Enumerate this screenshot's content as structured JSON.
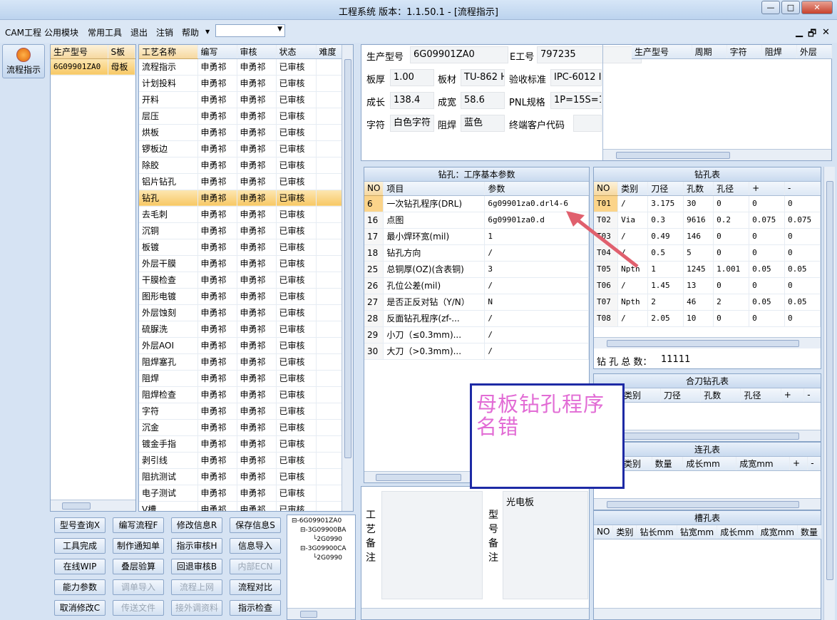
{
  "window": {
    "title": "工程系统   版本：1.1.50.1 - [流程指示]",
    "min": "—",
    "max": "□",
    "close": "✕"
  },
  "menu": {
    "items": [
      "CAM工程",
      "公用模块",
      "常用工具",
      "退出",
      "注销",
      "帮助"
    ],
    "combo_value": "",
    "mdi": [
      "▁",
      "🗗",
      "✕"
    ]
  },
  "side": {
    "label": "流程指示"
  },
  "model_list": {
    "headers": [
      "生产型号",
      "S板"
    ],
    "rows": [
      [
        "6G09901ZA0",
        "母板"
      ]
    ]
  },
  "process": {
    "headers": [
      "工艺名称",
      "编写",
      "审核",
      "状态",
      "难度"
    ],
    "rows": [
      [
        "流程指示",
        "申勇祁",
        "申勇祁",
        "已审核"
      ],
      [
        "计划投料",
        "申勇祁",
        "申勇祁",
        "已审核"
      ],
      [
        "开料",
        "申勇祁",
        "申勇祁",
        "已审核"
      ],
      [
        "层压",
        "申勇祁",
        "申勇祁",
        "已审核"
      ],
      [
        "烘板",
        "申勇祁",
        "申勇祁",
        "已审核"
      ],
      [
        "锣板边",
        "申勇祁",
        "申勇祁",
        "已审核"
      ],
      [
        "除胶",
        "申勇祁",
        "申勇祁",
        "已审核"
      ],
      [
        "铝片钻孔",
        "申勇祁",
        "申勇祁",
        "已审核"
      ],
      [
        "钻孔",
        "申勇祁",
        "申勇祁",
        "已审核"
      ],
      [
        "去毛刺",
        "申勇祁",
        "申勇祁",
        "已审核"
      ],
      [
        "沉铜",
        "申勇祁",
        "申勇祁",
        "已审核"
      ],
      [
        "板镀",
        "申勇祁",
        "申勇祁",
        "已审核"
      ],
      [
        "外层干膜",
        "申勇祁",
        "申勇祁",
        "已审核"
      ],
      [
        "干膜检查",
        "申勇祁",
        "申勇祁",
        "已审核"
      ],
      [
        "图形电镀",
        "申勇祁",
        "申勇祁",
        "已审核"
      ],
      [
        "外层蚀刻",
        "申勇祁",
        "申勇祁",
        "已审核"
      ],
      [
        "硫脲洗",
        "申勇祁",
        "申勇祁",
        "已审核"
      ],
      [
        "外层AOI",
        "申勇祁",
        "申勇祁",
        "已审核"
      ],
      [
        "阻焊塞孔",
        "申勇祁",
        "申勇祁",
        "已审核"
      ],
      [
        "阻焊",
        "申勇祁",
        "申勇祁",
        "已审核"
      ],
      [
        "阻焊检查",
        "申勇祁",
        "申勇祁",
        "已审核"
      ],
      [
        "字符",
        "申勇祁",
        "申勇祁",
        "已审核"
      ],
      [
        "沉金",
        "申勇祁",
        "申勇祁",
        "已审核"
      ],
      [
        "镀金手指",
        "申勇祁",
        "申勇祁",
        "已审核"
      ],
      [
        "剥引线",
        "申勇祁",
        "申勇祁",
        "已审核"
      ],
      [
        "阻抗测试",
        "申勇祁",
        "申勇祁",
        "已审核"
      ],
      [
        "电子测试",
        "申勇祁",
        "申勇祁",
        "已审核"
      ],
      [
        "V槽",
        "申勇祁",
        "申勇祁",
        "已审核"
      ]
    ],
    "selected_index": 8
  },
  "buttons": [
    [
      "型号查询X",
      "编写流程F",
      "修改信息R",
      "保存信息S"
    ],
    [
      "工具完成",
      "制作通知单",
      "指示审核H",
      "信息导入"
    ],
    [
      "在线WIP",
      "叠层验算",
      "回退审核B",
      "内部ECN"
    ],
    [
      "能力参数",
      "调单导入",
      "流程上网",
      "流程对比"
    ],
    [
      "取消修改C",
      "传送文件",
      "接外调资料",
      "指示检查"
    ]
  ],
  "disabled_buttons": [
    "内部ECN",
    "调单导入",
    "流程上网",
    "传送文件",
    "接外调资料"
  ],
  "tree": {
    "root": "6G09901ZA0",
    "children": [
      {
        "name": "3G09900BA",
        "sub": "2G0990"
      },
      {
        "name": "3G09900CA",
        "sub": "2G0990"
      }
    ]
  },
  "info": {
    "prod_label": "生产型号",
    "prod": "6G09901ZA0",
    "e_label": "E工号",
    "e": "797235",
    "thick_label": "板厚",
    "thick": "1.00",
    "mat_label": "板材",
    "mat": "TU-862 H",
    "std_label": "验收标准",
    "std": "IPC-6012 I",
    "len_label": "成长",
    "len": "138.4",
    "wid_label": "成宽",
    "wid": "58.6",
    "pnl_label": "PNL规格",
    "pnl": "1P=15S=1",
    "char_label": "字符",
    "char": "白色字符",
    "mask_label": "阻焊",
    "mask": "蓝色",
    "cust_label": "终端客户代码",
    "cust": ""
  },
  "right_top_headers": [
    "生产型号",
    "周期",
    "字符",
    "阻焊",
    "外层"
  ],
  "drill_params": {
    "title": "钻孔：工序基本参数",
    "headers": [
      "NO",
      "项目",
      "参数"
    ],
    "rows": [
      [
        "6",
        "一次钻孔程序(DRL)",
        "6g09901za0.drl4-6"
      ],
      [
        "16",
        "点图",
        "6g09901za0.d"
      ],
      [
        "17",
        "最小焊环宽(mil)",
        "1"
      ],
      [
        "18",
        "钻孔方向",
        "/"
      ],
      [
        "25",
        "总铜厚(OZ)(含表铜)",
        "3"
      ],
      [
        "26",
        "孔位公差(mil)",
        "/"
      ],
      [
        "27",
        "是否正反对钻（Y/N）",
        "N"
      ],
      [
        "28",
        "反面钻孔程序(zf-...",
        "/"
      ],
      [
        "29",
        "小刀（≤0.3mm)...",
        "/"
      ],
      [
        "30",
        "大刀（>0.3mm)...",
        "/"
      ]
    ]
  },
  "drill_table": {
    "title": "钻孔表",
    "headers": [
      "NO",
      "类别",
      "刀径",
      "孔数",
      "孔径",
      "+",
      "-"
    ],
    "rows": [
      [
        "T01",
        "/",
        "3.175",
        "30",
        "0",
        "0",
        "0"
      ],
      [
        "T02",
        "Via",
        "0.3",
        "9616",
        "0.2",
        "0.075",
        "0.075"
      ],
      [
        "T03",
        "/",
        "0.49",
        "146",
        "0",
        "0",
        "0"
      ],
      [
        "T04",
        "/",
        "0.5",
        "5",
        "0",
        "0",
        "0"
      ],
      [
        "T05",
        "Npth",
        "1",
        "1245",
        "1.001",
        "0.05",
        "0.05"
      ],
      [
        "T06",
        "/",
        "1.45",
        "13",
        "0",
        "0",
        "0"
      ],
      [
        "T07",
        "Npth",
        "2",
        "46",
        "2",
        "0.05",
        "0.05"
      ],
      [
        "T08",
        "/",
        "2.05",
        "10",
        "0",
        "0",
        "0"
      ]
    ],
    "total_label": "钻 孔 总 数：",
    "total": "11111"
  },
  "combo_drill": {
    "title": "合刀钻孔表",
    "headers": [
      "类别",
      "刀径",
      "孔数",
      "孔径",
      "+",
      "-"
    ]
  },
  "link_holes": {
    "title": "连孔表",
    "headers": [
      "类别",
      "数量",
      "成长mm",
      "成宽mm",
      "+",
      "-"
    ]
  },
  "slot_table": {
    "title": "槽孔表",
    "headers": [
      "NO",
      "类别",
      "钻长mm",
      "钻宽mm",
      "成长mm",
      "成宽mm",
      "数量"
    ]
  },
  "notes": {
    "craft_label": "工艺备注",
    "model_label": "型号备注",
    "model_note": "光电板"
  },
  "callout": {
    "text": "母板钻孔程序名错"
  },
  "colors": {
    "accent": "#f7c865",
    "callout_border": "#1d2aa5",
    "callout_text": "#e26cd5",
    "arrow": "#e0606e"
  }
}
